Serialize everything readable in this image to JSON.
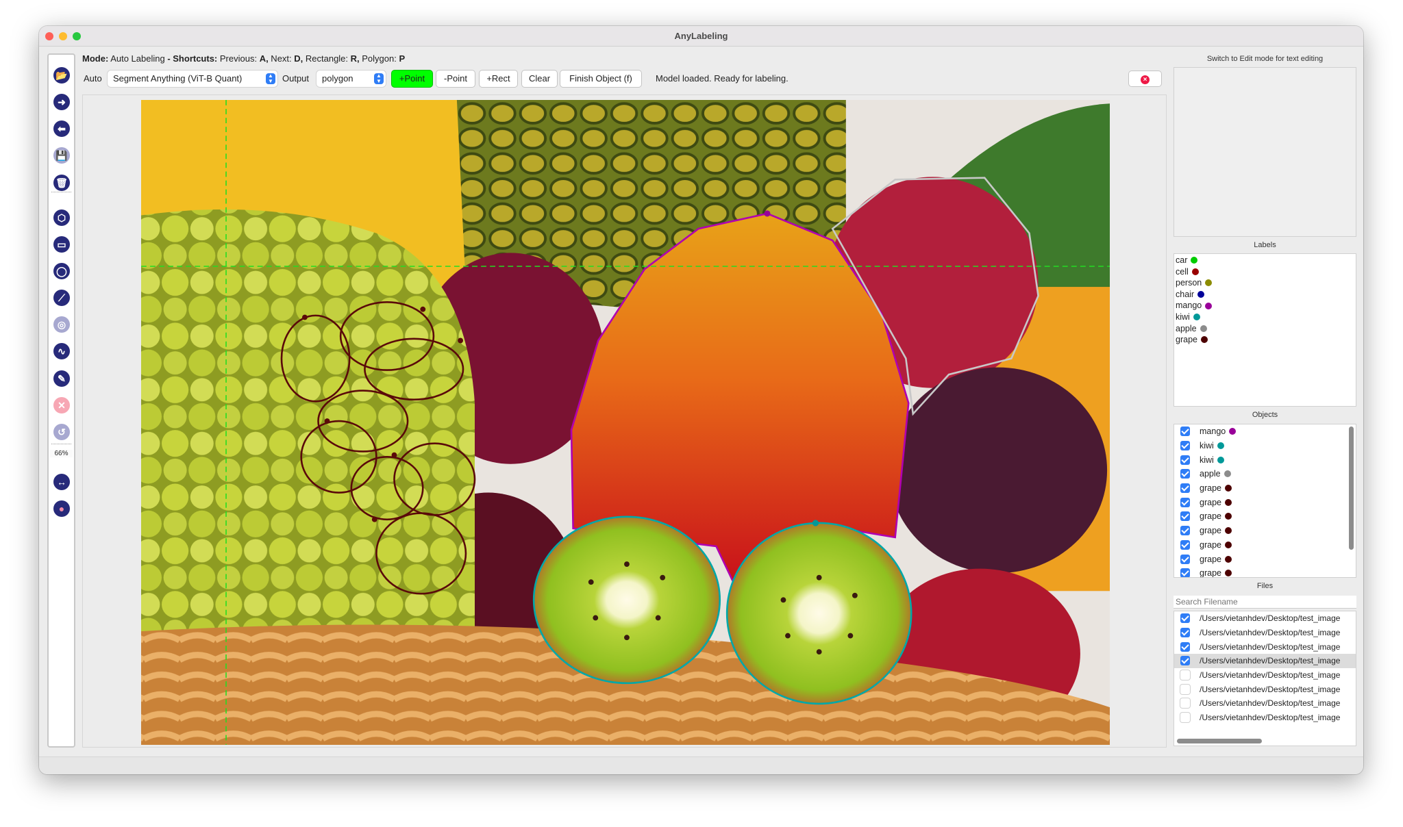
{
  "window": {
    "title": "AnyLabeling"
  },
  "toolbar": {
    "items": [
      {
        "name": "open-folder-icon"
      },
      {
        "name": "next-image-icon"
      },
      {
        "name": "prev-image-icon"
      },
      {
        "name": "save-icon",
        "disabled": true
      },
      {
        "name": "delete-icon"
      },
      {
        "name": "polygon-icon"
      },
      {
        "name": "rectangle-icon"
      },
      {
        "name": "circle-icon"
      },
      {
        "name": "line-icon"
      },
      {
        "name": "point-icon",
        "disabled": true
      },
      {
        "name": "linestrip-icon"
      },
      {
        "name": "edit-pencil-icon"
      },
      {
        "name": "close-red-icon",
        "disabled": true
      },
      {
        "name": "undo-icon",
        "disabled": true
      },
      {
        "name": "fit-width-icon"
      },
      {
        "name": "brain-auto-label-icon"
      }
    ],
    "zoom": "66%"
  },
  "mode": {
    "mode_label": "Mode:",
    "mode_value": "Auto Labeling",
    "dash": " - ",
    "shortcuts_label": "Shortcuts:",
    "s1": " Previous: ",
    "k1": "A,",
    "s2": " Next: ",
    "k2": "D,",
    "s3": " Rectangle: ",
    "k3": "R,",
    "s4": " Polygon: ",
    "k4": "P"
  },
  "controls": {
    "auto_label": "Auto",
    "model_select": "Segment Anything (ViT-B Quant)",
    "output_label": "Output",
    "output_select": "polygon",
    "add_point": "+Point",
    "remove_point": "-Point",
    "add_rect": "+Rect",
    "clear": "Clear",
    "finish": "Finish Object (f)",
    "status": "Model loaded. Ready for labeling.",
    "accent": "#2f7df6",
    "add_point_color": "#00ff00"
  },
  "right_panel": {
    "text_hint": "Switch to Edit mode for text editing",
    "labels_header": "Labels",
    "labels": [
      {
        "name": "car",
        "color": "#00cc00"
      },
      {
        "name": "cell",
        "color": "#990000"
      },
      {
        "name": "person",
        "color": "#8c8c00"
      },
      {
        "name": "chair",
        "color": "#000099"
      },
      {
        "name": "mango",
        "color": "#990099"
      },
      {
        "name": "kiwi",
        "color": "#009999"
      },
      {
        "name": "apple",
        "color": "#8c8c8c"
      },
      {
        "name": "grape",
        "color": "#4d0000"
      }
    ],
    "objects_header": "Objects",
    "objects": [
      {
        "name": "mango",
        "color": "#990099",
        "checked": true
      },
      {
        "name": "kiwi",
        "color": "#009999",
        "checked": true
      },
      {
        "name": "kiwi",
        "color": "#009999",
        "checked": true
      },
      {
        "name": "apple",
        "color": "#8c8c8c",
        "checked": true
      },
      {
        "name": "grape",
        "color": "#4d0000",
        "checked": true
      },
      {
        "name": "grape",
        "color": "#4d0000",
        "checked": true
      },
      {
        "name": "grape",
        "color": "#4d0000",
        "checked": true
      },
      {
        "name": "grape",
        "color": "#4d0000",
        "checked": true
      },
      {
        "name": "grape",
        "color": "#4d0000",
        "checked": true
      },
      {
        "name": "grape",
        "color": "#4d0000",
        "checked": true
      },
      {
        "name": "grape",
        "color": "#4d0000",
        "checked": true
      }
    ],
    "files_header": "Files",
    "search_placeholder": "Search Filename",
    "files": [
      {
        "path": "/Users/vietanhdev/Desktop/test_image",
        "checked": true,
        "selected": false
      },
      {
        "path": "/Users/vietanhdev/Desktop/test_image",
        "checked": true,
        "selected": false
      },
      {
        "path": "/Users/vietanhdev/Desktop/test_image",
        "checked": true,
        "selected": false
      },
      {
        "path": "/Users/vietanhdev/Desktop/test_image",
        "checked": true,
        "selected": true
      },
      {
        "path": "/Users/vietanhdev/Desktop/test_image",
        "checked": false,
        "selected": false
      },
      {
        "path": "/Users/vietanhdev/Desktop/test_image",
        "checked": false,
        "selected": false
      },
      {
        "path": "/Users/vietanhdev/Desktop/test_image",
        "checked": false,
        "selected": false
      },
      {
        "path": "/Users/vietanhdev/Desktop/test_image",
        "checked": false,
        "selected": false
      }
    ]
  }
}
